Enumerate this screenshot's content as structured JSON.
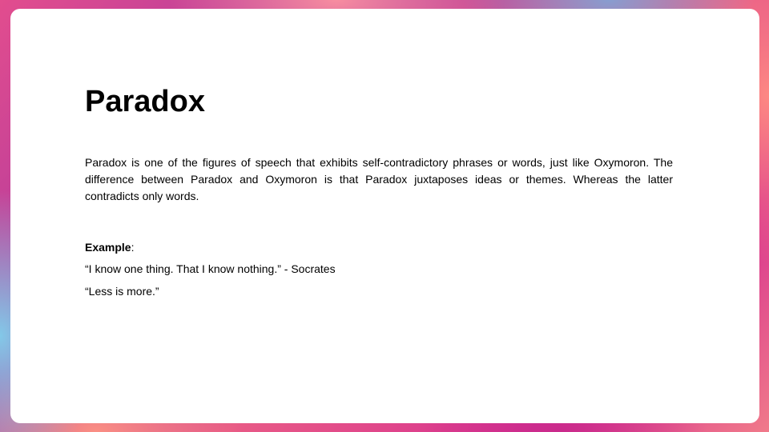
{
  "slide": {
    "title": "Paradox",
    "body": "Paradox is one of the figures of speech that exhibits self-contradictory phrases or words, just like Oxymoron. The difference between Paradox and Oxymoron is that Paradox juxtaposes ideas or themes. Whereas the latter contradicts only words.",
    "example_label": "Example",
    "example_colon": ":",
    "examples": [
      "“I know one thing. That I know nothing.” - Socrates",
      "“Less is more.”"
    ]
  },
  "colors": {
    "card_background": "#ffffff",
    "text": "#000000",
    "frame_primary": "#e0488f",
    "frame_accent_blue": "#80d0ec",
    "frame_accent_coral": "#ff8c82"
  }
}
